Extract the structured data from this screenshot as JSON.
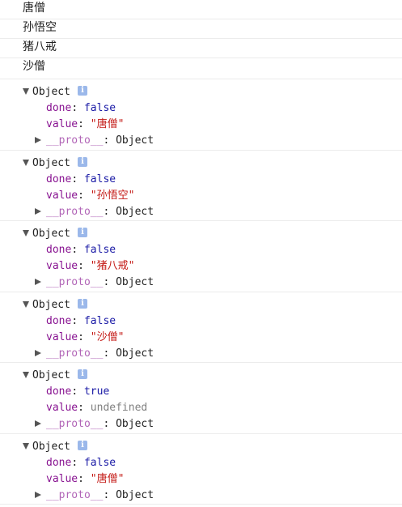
{
  "log_lines": [
    "唐僧",
    "孙悟空",
    "猪八戒",
    "沙僧"
  ],
  "objects": [
    {
      "label": "Object",
      "done_key": "done",
      "done": "false",
      "value_key": "value",
      "value": "\"唐僧\"",
      "value_kind": "string",
      "proto_key": "__proto__",
      "proto_value": "Object"
    },
    {
      "label": "Object",
      "done_key": "done",
      "done": "false",
      "value_key": "value",
      "value": "\"孙悟空\"",
      "value_kind": "string",
      "proto_key": "__proto__",
      "proto_value": "Object"
    },
    {
      "label": "Object",
      "done_key": "done",
      "done": "false",
      "value_key": "value",
      "value": "\"猪八戒\"",
      "value_kind": "string",
      "proto_key": "__proto__",
      "proto_value": "Object"
    },
    {
      "label": "Object",
      "done_key": "done",
      "done": "false",
      "value_key": "value",
      "value": "\"沙僧\"",
      "value_kind": "string",
      "proto_key": "__proto__",
      "proto_value": "Object"
    },
    {
      "label": "Object",
      "done_key": "done",
      "done": "true",
      "value_key": "value",
      "value": "undefined",
      "value_kind": "undefined",
      "proto_key": "__proto__",
      "proto_value": "Object"
    },
    {
      "label": "Object",
      "done_key": "done",
      "done": "false",
      "value_key": "value",
      "value": "\"唐僧\"",
      "value_kind": "string",
      "proto_key": "__proto__",
      "proto_value": "Object"
    }
  ],
  "info_badge_glyph": "i",
  "colors": {
    "key": "#881391",
    "boolean": "#1a1aa6",
    "string": "#c41a16",
    "undefined": "#808080",
    "info_badge": "#9bb8ea",
    "row_divider": "#ececec"
  },
  "icons": {
    "expanded": "triangle-down-icon",
    "collapsed": "triangle-right-icon",
    "info": "info-icon"
  }
}
